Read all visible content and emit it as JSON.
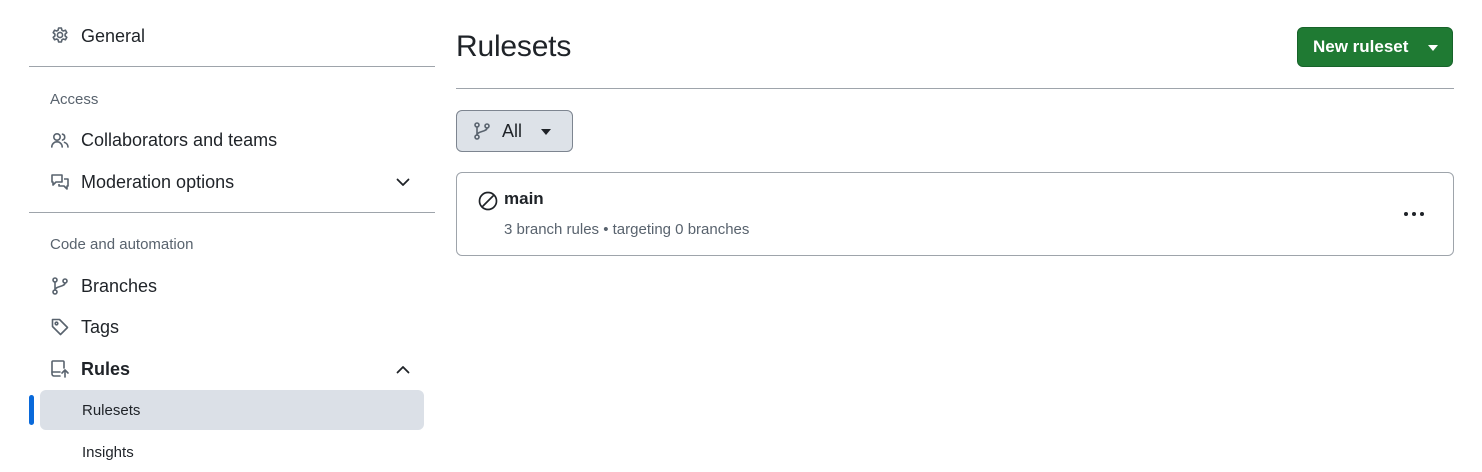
{
  "sidebar": {
    "general": "General",
    "access_heading": "Access",
    "collaborators": "Collaborators and teams",
    "moderation": "Moderation options",
    "code_heading": "Code and automation",
    "branches": "Branches",
    "tags": "Tags",
    "rules": "Rules",
    "rulesets": "Rulesets",
    "insights": "Insights"
  },
  "main": {
    "title": "Rulesets",
    "new_button": "New ruleset",
    "filter_label": "All",
    "rulesets": [
      {
        "name": "main",
        "meta": "3 branch rules • targeting 0 branches"
      }
    ]
  },
  "colors": {
    "primary_button": "#1f7a33",
    "active_indicator": "#0969da",
    "active_bg": "#dbe0e7"
  },
  "icons": {
    "general": "gear-icon",
    "collaborators": "people-icon",
    "moderation": "comment-discussion-icon",
    "branches": "git-branch-icon",
    "tags": "tag-icon",
    "rules": "repo-push-icon",
    "ruleset_status": "circle-slash-icon",
    "more": "kebab-horizontal-icon"
  }
}
